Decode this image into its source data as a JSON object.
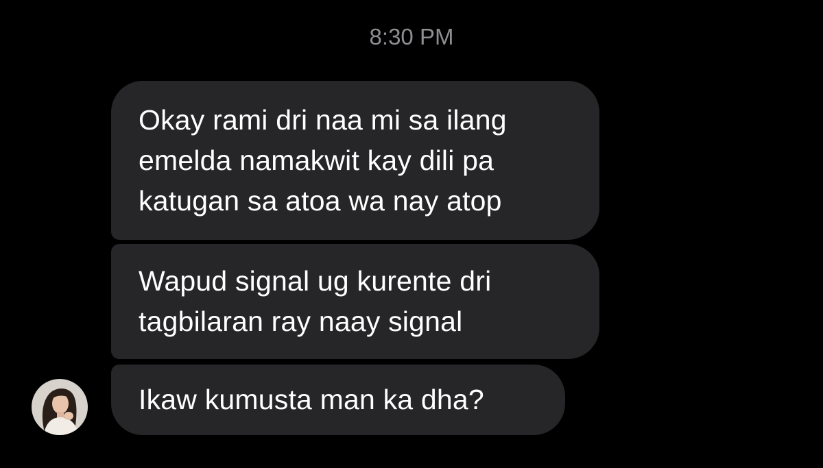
{
  "timestamp": "8:30 PM",
  "messages": [
    {
      "lines": [
        "Okay rami dri naa mi sa ilang",
        "emelda namakwit kay dili pa",
        "katugan sa atoa wa nay atop"
      ]
    },
    {
      "lines": [
        "Wapud signal ug kurente dri",
        "tagbilaran ray naay signal"
      ]
    },
    {
      "lines": [
        "Ikaw kumusta man ka dha?"
      ]
    }
  ],
  "avatar": {
    "icon": "profile-photo"
  },
  "colors": {
    "background": "#000000",
    "bubble": "#262628",
    "timestamp": "#8e8e93",
    "text": "#ffffff"
  }
}
